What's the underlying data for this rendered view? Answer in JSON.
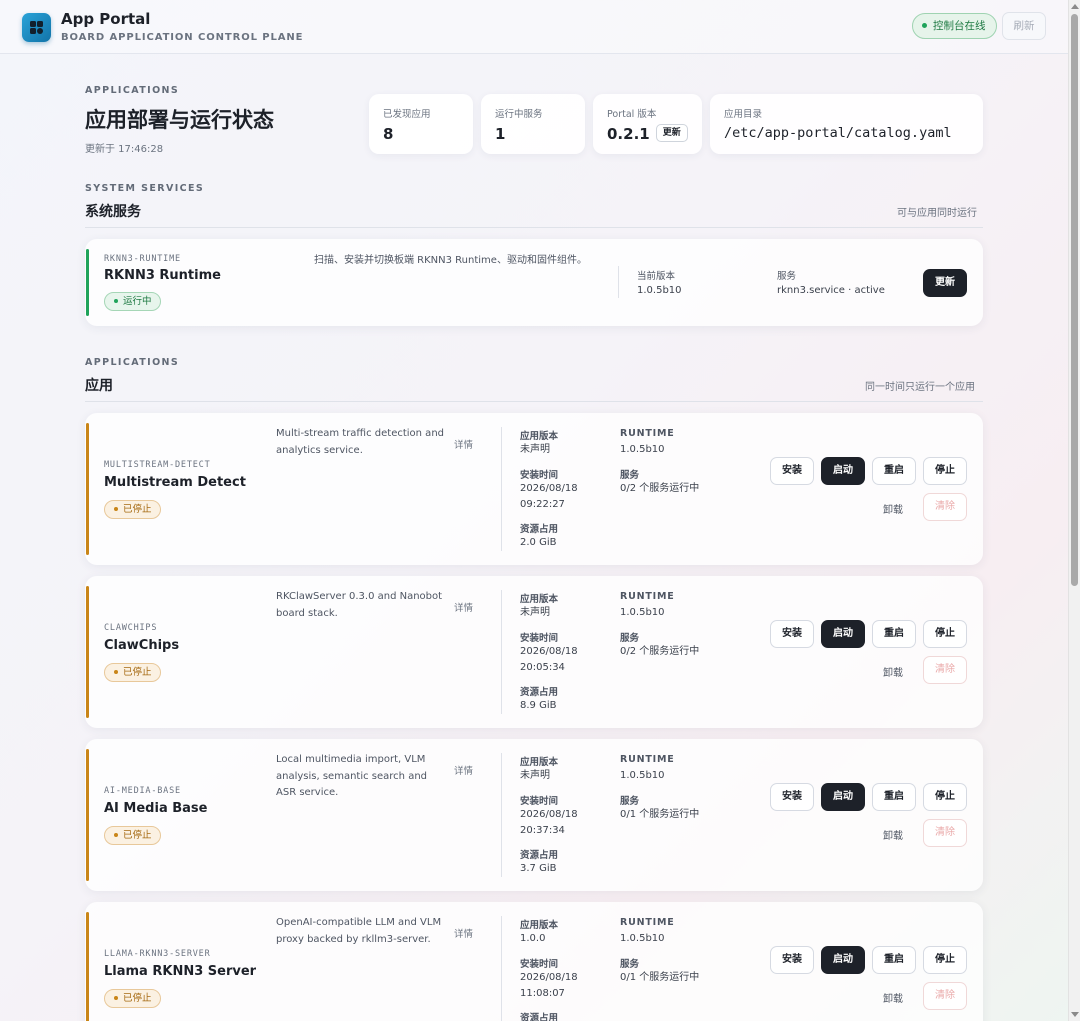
{
  "app": {
    "title": "App Portal",
    "subtitle": "BOARD APPLICATION CONTROL PLANE",
    "status": "控制台在线",
    "refresh": "刷新"
  },
  "header": {
    "eyebrow": "APPLICATIONS",
    "title": "应用部署与运行状态",
    "updated": "更新于 17:46:28",
    "stats": {
      "discovered_label": "已发现应用",
      "discovered_value": "8",
      "running_label": "运行中服务",
      "running_value": "1",
      "portal_label": "Portal 版本",
      "portal_value": "0.2.1",
      "portal_update": "更新",
      "catalog_label": "应用目录",
      "catalog_value": "/etc/app-portal/catalog.yaml"
    }
  },
  "system": {
    "eyebrow": "SYSTEM SERVICES",
    "title": "系统服务",
    "note": "可与应用同时运行",
    "card": {
      "slug": "RKNN3-RUNTIME",
      "name": "RKNN3 Runtime",
      "status": "运行中",
      "description": "扫描、安装并切换板端 RKNN3 Runtime、驱动和固件组件。",
      "version_label": "当前版本",
      "version_value": "1.0.5b10",
      "service_label": "服务",
      "service_value": "rknn3.service · active",
      "update": "更新"
    }
  },
  "apps_section": {
    "eyebrow": "APPLICATIONS",
    "title": "应用",
    "note": "同一时间只运行一个应用"
  },
  "labels": {
    "detail": "详情",
    "app_version": "应用版本",
    "runtime": "RUNTIME",
    "install_time": "安装时间",
    "service": "服务",
    "resource": "资源占用",
    "install": "安装",
    "start": "启动",
    "restart": "重启",
    "stop": "停止",
    "uninstall": "卸载",
    "purge": "清除",
    "stopped": "已停止"
  },
  "apps": [
    {
      "slug": "MULTISTREAM-DETECT",
      "name": "Multistream Detect",
      "description": "Multi-stream traffic detection and analytics service.",
      "app_version": "未声明",
      "runtime": "1.0.5b10",
      "install_date": "2026/08/18",
      "install_time": "09:22:27",
      "service": "0/2 个服务运行中",
      "resource": "2.0 GiB"
    },
    {
      "slug": "CLAWCHIPS",
      "name": "ClawChips",
      "description": "RKClawServer 0.3.0 and Nanobot board stack.",
      "app_version": "未声明",
      "runtime": "1.0.5b10",
      "install_date": "2026/08/18",
      "install_time": "20:05:34",
      "service": "0/2 个服务运行中",
      "resource": "8.9 GiB"
    },
    {
      "slug": "AI-MEDIA-BASE",
      "name": "AI Media Base",
      "description": "Local multimedia import, VLM analysis, semantic search and ASR service.",
      "app_version": "未声明",
      "runtime": "1.0.5b10",
      "install_date": "2026/08/18",
      "install_time": "20:37:34",
      "service": "0/1 个服务运行中",
      "resource": "3.7 GiB"
    },
    {
      "slug": "LLAMA-RKNN3-SERVER",
      "name": "Llama RKNN3 Server",
      "description": "OpenAI-compatible LLM and VLM proxy backed by rkllm3-server.",
      "app_version": "1.0.0",
      "runtime": "1.0.5b10",
      "install_date": "2026/08/18",
      "install_time": "11:08:07",
      "service": "0/1 个服务运行中",
      "resource": ""
    }
  ],
  "colors": {
    "running_accent": "#1fa35a",
    "stopped_accent": "#c98518",
    "primary_button": "#1d2129"
  }
}
